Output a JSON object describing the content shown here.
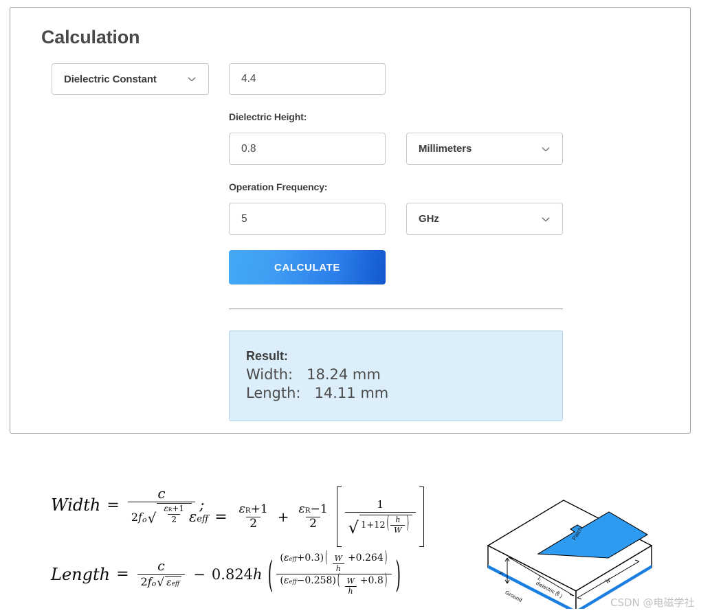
{
  "card": {
    "title": "Calculation"
  },
  "form": {
    "dielectric_constant_select": "Dielectric Constant",
    "dielectric_constant_value": "4.4",
    "dielectric_height_label": "Dielectric Height:",
    "dielectric_height_value": "0.8",
    "dielectric_height_unit": "Millimeters",
    "operation_frequency_label": "Operation Frequency:",
    "operation_frequency_value": "5",
    "operation_frequency_unit": "GHz",
    "calculate_button": "CALCULATE"
  },
  "result": {
    "heading": "Result:",
    "width_line": "Width:   18.24 mm",
    "length_line": "Length:   14.11 mm",
    "width_label": "Width:",
    "width_value": "18.24 mm",
    "length_label": "Length:",
    "length_value": "14.11 mm"
  },
  "formulas": {
    "width": {
      "lhs": "Width",
      "eq": "=",
      "numerator": "c",
      "denominator_coeff": "2",
      "denominator_f": "f",
      "denominator_f_sub": "o",
      "radicand_num_eps": "ε",
      "radicand_num_eps_sub": "R",
      "radicand_num_plus": "+1",
      "radicand_den": "2",
      "semicolon": ";"
    },
    "eps_eff": {
      "lhs_eps": "ε",
      "lhs_sub": "eff",
      "eq": "=",
      "t1_num_eps": "ε",
      "t1_num_sub": "R",
      "t1_num_rest": "+1",
      "t1_den": "2",
      "plus": "+",
      "t2_num_eps": "ε",
      "t2_num_sub": "R",
      "t2_num_rest": "−1",
      "t2_den": "2",
      "br_num": "1",
      "br_den_pre": "1+12",
      "br_den_frac_num": "h",
      "br_den_frac_den": "W"
    },
    "length": {
      "lhs": "Length",
      "eq": "=",
      "numerator": "c",
      "den_coeff": "2",
      "den_f": "f",
      "den_f_sub": "o",
      "den_eps": "ε",
      "den_eps_sub": "eff",
      "minus": "−",
      "coeff": "0.824",
      "h": "h",
      "num_a_eps": "ε",
      "num_a_sub": "eff",
      "num_a_rest": "+0.3",
      "num_b_frac_num": "W",
      "num_b_frac_den": "h",
      "num_b_rest": "+0.264",
      "den_a_eps": "ε",
      "den_a_sub": "eff",
      "den_a_rest": "−0.258",
      "den_b_frac_num": "W",
      "den_b_frac_den": "h",
      "den_b_rest": "+0.8"
    }
  },
  "diagram": {
    "patch_label": "Patch",
    "length_label": "L",
    "width_label": "W",
    "height_label": "h",
    "dielectric_label": "dielectric (ε R )",
    "ground_label": "Ground",
    "patch_color": "#2e9bf0",
    "ground_color": "#1a7fe0"
  },
  "watermark": {
    "text": "CSDN @电磁学社"
  },
  "colors": {
    "accent_light": "#42a9f6",
    "accent_dark": "#1257cf",
    "result_bg": "#ddeefb",
    "result_border": "#aed3ee",
    "card_border": "#9a9a9a"
  }
}
